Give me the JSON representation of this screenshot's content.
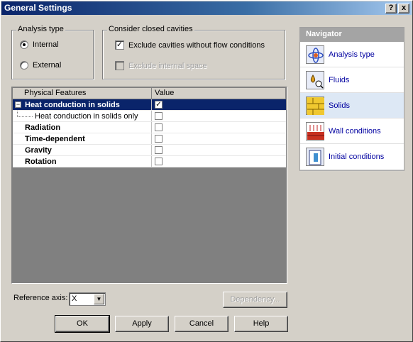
{
  "window": {
    "title": "General Settings",
    "help_btn": "?",
    "close_btn": "x"
  },
  "analysis_type": {
    "legend": "Analysis type",
    "options": [
      {
        "label": "Internal",
        "selected": true
      },
      {
        "label": "External",
        "selected": false
      }
    ]
  },
  "cavities": {
    "legend": "Consider closed cavities",
    "exclude_no_flow": {
      "label": "Exclude cavities without flow conditions",
      "checked": true
    },
    "exclude_internal": {
      "label": "Exclude internal space",
      "checked": false,
      "enabled": false
    }
  },
  "grid": {
    "columns": [
      "Physical Features",
      "Value"
    ],
    "rows": [
      {
        "feature": "Heat conduction in solids",
        "checked": true,
        "bold": true,
        "selected": true,
        "expander": "−"
      },
      {
        "feature": "Heat conduction in solids only",
        "checked": false,
        "bold": false,
        "child": true
      },
      {
        "feature": "Radiation",
        "checked": false,
        "bold": true
      },
      {
        "feature": "Time-dependent",
        "checked": false,
        "bold": true
      },
      {
        "feature": "Gravity",
        "checked": false,
        "bold": true
      },
      {
        "feature": "Rotation",
        "checked": false,
        "bold": true
      }
    ]
  },
  "reference_axis": {
    "label": "Reference axis:",
    "value": "X",
    "arrow": "▼"
  },
  "buttons": {
    "dependency": "Dependency...",
    "ok": "OK",
    "apply": "Apply",
    "cancel": "Cancel",
    "help": "Help"
  },
  "navigator": {
    "title": "Navigator",
    "items": [
      {
        "label": "Analysis type",
        "icon": "analysis-type-icon",
        "active": false
      },
      {
        "label": "Fluids",
        "icon": "fluids-icon",
        "active": false
      },
      {
        "label": "Solids",
        "icon": "solids-icon",
        "active": true
      },
      {
        "label": "Wall conditions",
        "icon": "wall-conditions-icon",
        "active": false
      },
      {
        "label": "Initial conditions",
        "icon": "initial-conditions-icon",
        "active": false
      }
    ]
  },
  "colors": {
    "title_bar": "#0a246a",
    "selection": "#0a246a",
    "navigator_header": "#a4a4a4",
    "navigator_link": "#0000a0"
  }
}
